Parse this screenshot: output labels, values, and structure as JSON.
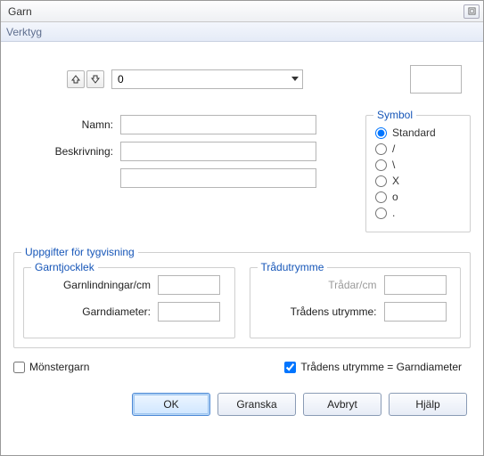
{
  "window": {
    "title": "Garn"
  },
  "menu": {
    "verktyg": "Verktyg"
  },
  "top": {
    "combo_value": "0"
  },
  "fields": {
    "namn_label": "Namn:",
    "beskrivning_label": "Beskrivning:",
    "namn_value": "",
    "beskrivning_value": "",
    "beskrivning2_value": ""
  },
  "symbol": {
    "legend": "Symbol",
    "options": {
      "standard": "Standard",
      "slash": "/",
      "backslash": "\\",
      "x": "X",
      "o": "o",
      "dot": "."
    },
    "selected": "standard"
  },
  "tygvisning": {
    "legend": "Uppgifter för tygvisning",
    "garntjocklek": {
      "legend": "Garntjocklek",
      "lindningar_label": "Garnlindningar/cm",
      "diameter_label": "Garndiameter:",
      "lindningar_value": "",
      "diameter_value": ""
    },
    "tradutrymme": {
      "legend": "Trådutrymme",
      "tradar_label": "Trådar/cm",
      "utrymme_label": "Trådens utrymme:",
      "tradar_value": "",
      "utrymme_value": ""
    }
  },
  "checks": {
    "monstergarn": "Mönstergarn",
    "utrymme_eq": "Trådens utrymme = Garndiameter",
    "monstergarn_checked": false,
    "utrymme_eq_checked": true
  },
  "buttons": {
    "ok": "OK",
    "granska": "Granska",
    "avbryt": "Avbryt",
    "hjalp": "Hjälp"
  }
}
